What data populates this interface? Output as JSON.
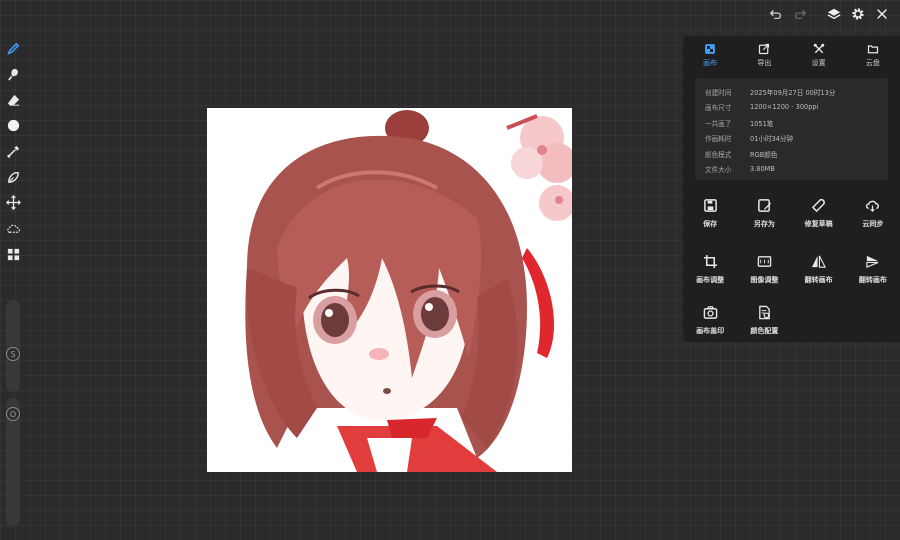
{
  "topbar": {
    "undo_icon": "undo-icon",
    "redo_icon": "redo-icon",
    "layers_icon": "layers-icon",
    "settings_icon": "gear-icon",
    "close_icon": "close-icon"
  },
  "tools": [
    {
      "name": "brush-tool",
      "icon": "pen-icon",
      "active": true
    },
    {
      "name": "smudge-tool",
      "icon": "smudge-icon"
    },
    {
      "name": "eraser-tool",
      "icon": "eraser-icon"
    },
    {
      "name": "color-tool",
      "icon": "color-dot-icon"
    },
    {
      "name": "eyedropper-tool",
      "icon": "eyedropper-icon"
    },
    {
      "name": "lasso-tool",
      "icon": "lasso-icon"
    },
    {
      "name": "move-tool",
      "icon": "move-icon"
    },
    {
      "name": "selection-tool",
      "icon": "cloud-selection-icon"
    },
    {
      "name": "gallery-tool",
      "icon": "grid-icon"
    }
  ],
  "sliders": {
    "size_label": "S",
    "opacity_label": "O"
  },
  "panel": {
    "tabs": [
      {
        "label": "画布",
        "icon": "canvas-icon",
        "active": true
      },
      {
        "label": "导出",
        "icon": "export-icon"
      },
      {
        "label": "设置",
        "icon": "tools-icon"
      },
      {
        "label": "云盘",
        "icon": "cloud-folder-icon"
      }
    ],
    "info": [
      {
        "key": "创建时间",
        "value": "2025年09月27日 00时13分"
      },
      {
        "key": "画布尺寸",
        "value": "1200×1200 - 300ppi"
      },
      {
        "key": "一共画了",
        "value": "1051笔"
      },
      {
        "key": "作画耗时",
        "value": "01小时34分钟"
      },
      {
        "key": "颜色模式",
        "value": "RGB颜色"
      },
      {
        "key": "文件大小",
        "value": "3.80MB"
      }
    ],
    "actions_row1": [
      {
        "label": "保存",
        "icon": "save-icon"
      },
      {
        "label": "另存为",
        "icon": "save-as-icon"
      },
      {
        "label": "修复草稿",
        "icon": "wrench-icon"
      },
      {
        "label": "云同步",
        "icon": "cloud-sync-icon"
      }
    ],
    "actions_row2": [
      {
        "label": "画布调整",
        "icon": "crop-icon"
      },
      {
        "label": "图像调整",
        "icon": "image-adjust-icon"
      },
      {
        "label": "翻转画布",
        "icon": "flip-horizontal-icon"
      },
      {
        "label": "翻转画布",
        "icon": "flip-vertical-icon"
      }
    ],
    "actions_row3": [
      {
        "label": "画布盖印",
        "icon": "camera-icon"
      },
      {
        "label": "颜色配置",
        "icon": "color-config-icon"
      }
    ]
  }
}
